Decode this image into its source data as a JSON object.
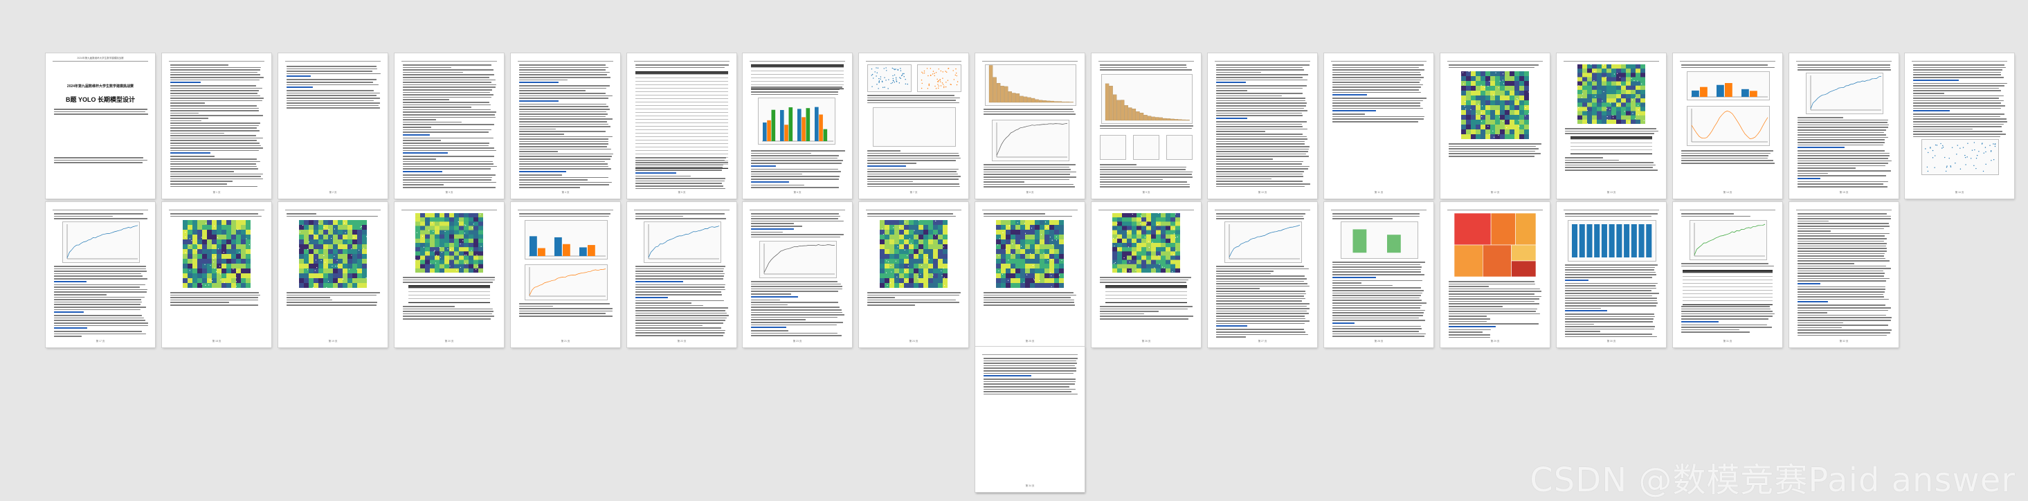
{
  "document": {
    "cover_title": "2024年第九届数维杯大学生数学建模挑战赛",
    "cover_subtitle": "B题 YOLO 长期模型设计"
  },
  "colors": {
    "background": "#e6e6e6",
    "page": "#ffffff",
    "heading": "#1e5bb8",
    "blue": "#1f77b4",
    "orange": "#ff7f0e",
    "green": "#2ca02c",
    "hist": "#d4a86a",
    "heat_dark": "#3b2a6b",
    "heat_mid": "#2a8b8b",
    "heat_light": "#9fd45a"
  },
  "pages": [
    {
      "type": "cover",
      "header": "2024年第九届数维杯大学生数学建模挑战赛",
      "footer": ""
    },
    {
      "type": "text",
      "header": "",
      "footer": "第 1 页"
    },
    {
      "type": "toc",
      "header": "",
      "footer": "第 2 页"
    },
    {
      "type": "text",
      "header": "",
      "footer": "第 3 页"
    },
    {
      "type": "text",
      "header": "",
      "footer": "第 4 页"
    },
    {
      "type": "table",
      "header": "",
      "footer": "第 5 页"
    },
    {
      "type": "bars_table",
      "header": "",
      "footer": "第 6 页"
    },
    {
      "type": "scatter_box",
      "header": "",
      "footer": "第 7 页"
    },
    {
      "type": "hist_line",
      "header": "",
      "footer": "第 8 页"
    },
    {
      "type": "hist_small",
      "header": "",
      "footer": "第 9 页"
    },
    {
      "type": "text",
      "header": "",
      "footer": "第 10 页"
    },
    {
      "type": "text_heat",
      "header": "",
      "footer": "第 11 页"
    },
    {
      "type": "heat",
      "header": "",
      "footer": "第 12 页"
    },
    {
      "type": "heat_table",
      "header": "",
      "footer": "第 13 页"
    },
    {
      "type": "bars_wave",
      "header": "",
      "footer": "第 14 页"
    },
    {
      "type": "line_text",
      "header": "",
      "footer": "第 15 页"
    },
    {
      "type": "text_scatter",
      "header": "",
      "footer": "第 16 页"
    },
    {
      "type": "line_text",
      "header": "",
      "footer": "第 17 页"
    },
    {
      "type": "heat",
      "header": "",
      "footer": "第 18 页"
    },
    {
      "type": "heat",
      "header": "",
      "footer": "第 19 页"
    },
    {
      "type": "heat_table",
      "header": "",
      "footer": "第 20 页"
    },
    {
      "type": "bars_line",
      "header": "",
      "footer": "第 21 页"
    },
    {
      "type": "line_text",
      "header": "",
      "footer": "第 22 页"
    },
    {
      "type": "text_line",
      "header": "",
      "footer": "第 23 页"
    },
    {
      "type": "heat",
      "header": "",
      "footer": "第 24 页"
    },
    {
      "type": "heat",
      "header": "",
      "footer": "第 25 页"
    },
    {
      "type": "heat_table",
      "header": "",
      "footer": "第 26 页"
    },
    {
      "type": "line_text",
      "header": "",
      "footer": "第 27 页"
    },
    {
      "type": "step_text",
      "header": "",
      "footer": "第 28 页"
    },
    {
      "type": "treemap",
      "header": "",
      "footer": "第 29 页"
    },
    {
      "type": "uniform_bars",
      "header": "",
      "footer": "第 30 页"
    },
    {
      "type": "scatter_table",
      "header": "",
      "footer": "第 31 页"
    },
    {
      "type": "text",
      "header": "",
      "footer": "第 32 页"
    },
    {
      "type": "text",
      "header": "",
      "footer": "第 33 页"
    },
    {
      "type": "text_end",
      "header": "",
      "footer": "第 34 页"
    }
  ],
  "watermark": "CSDN @数模竞赛Paid answer"
}
